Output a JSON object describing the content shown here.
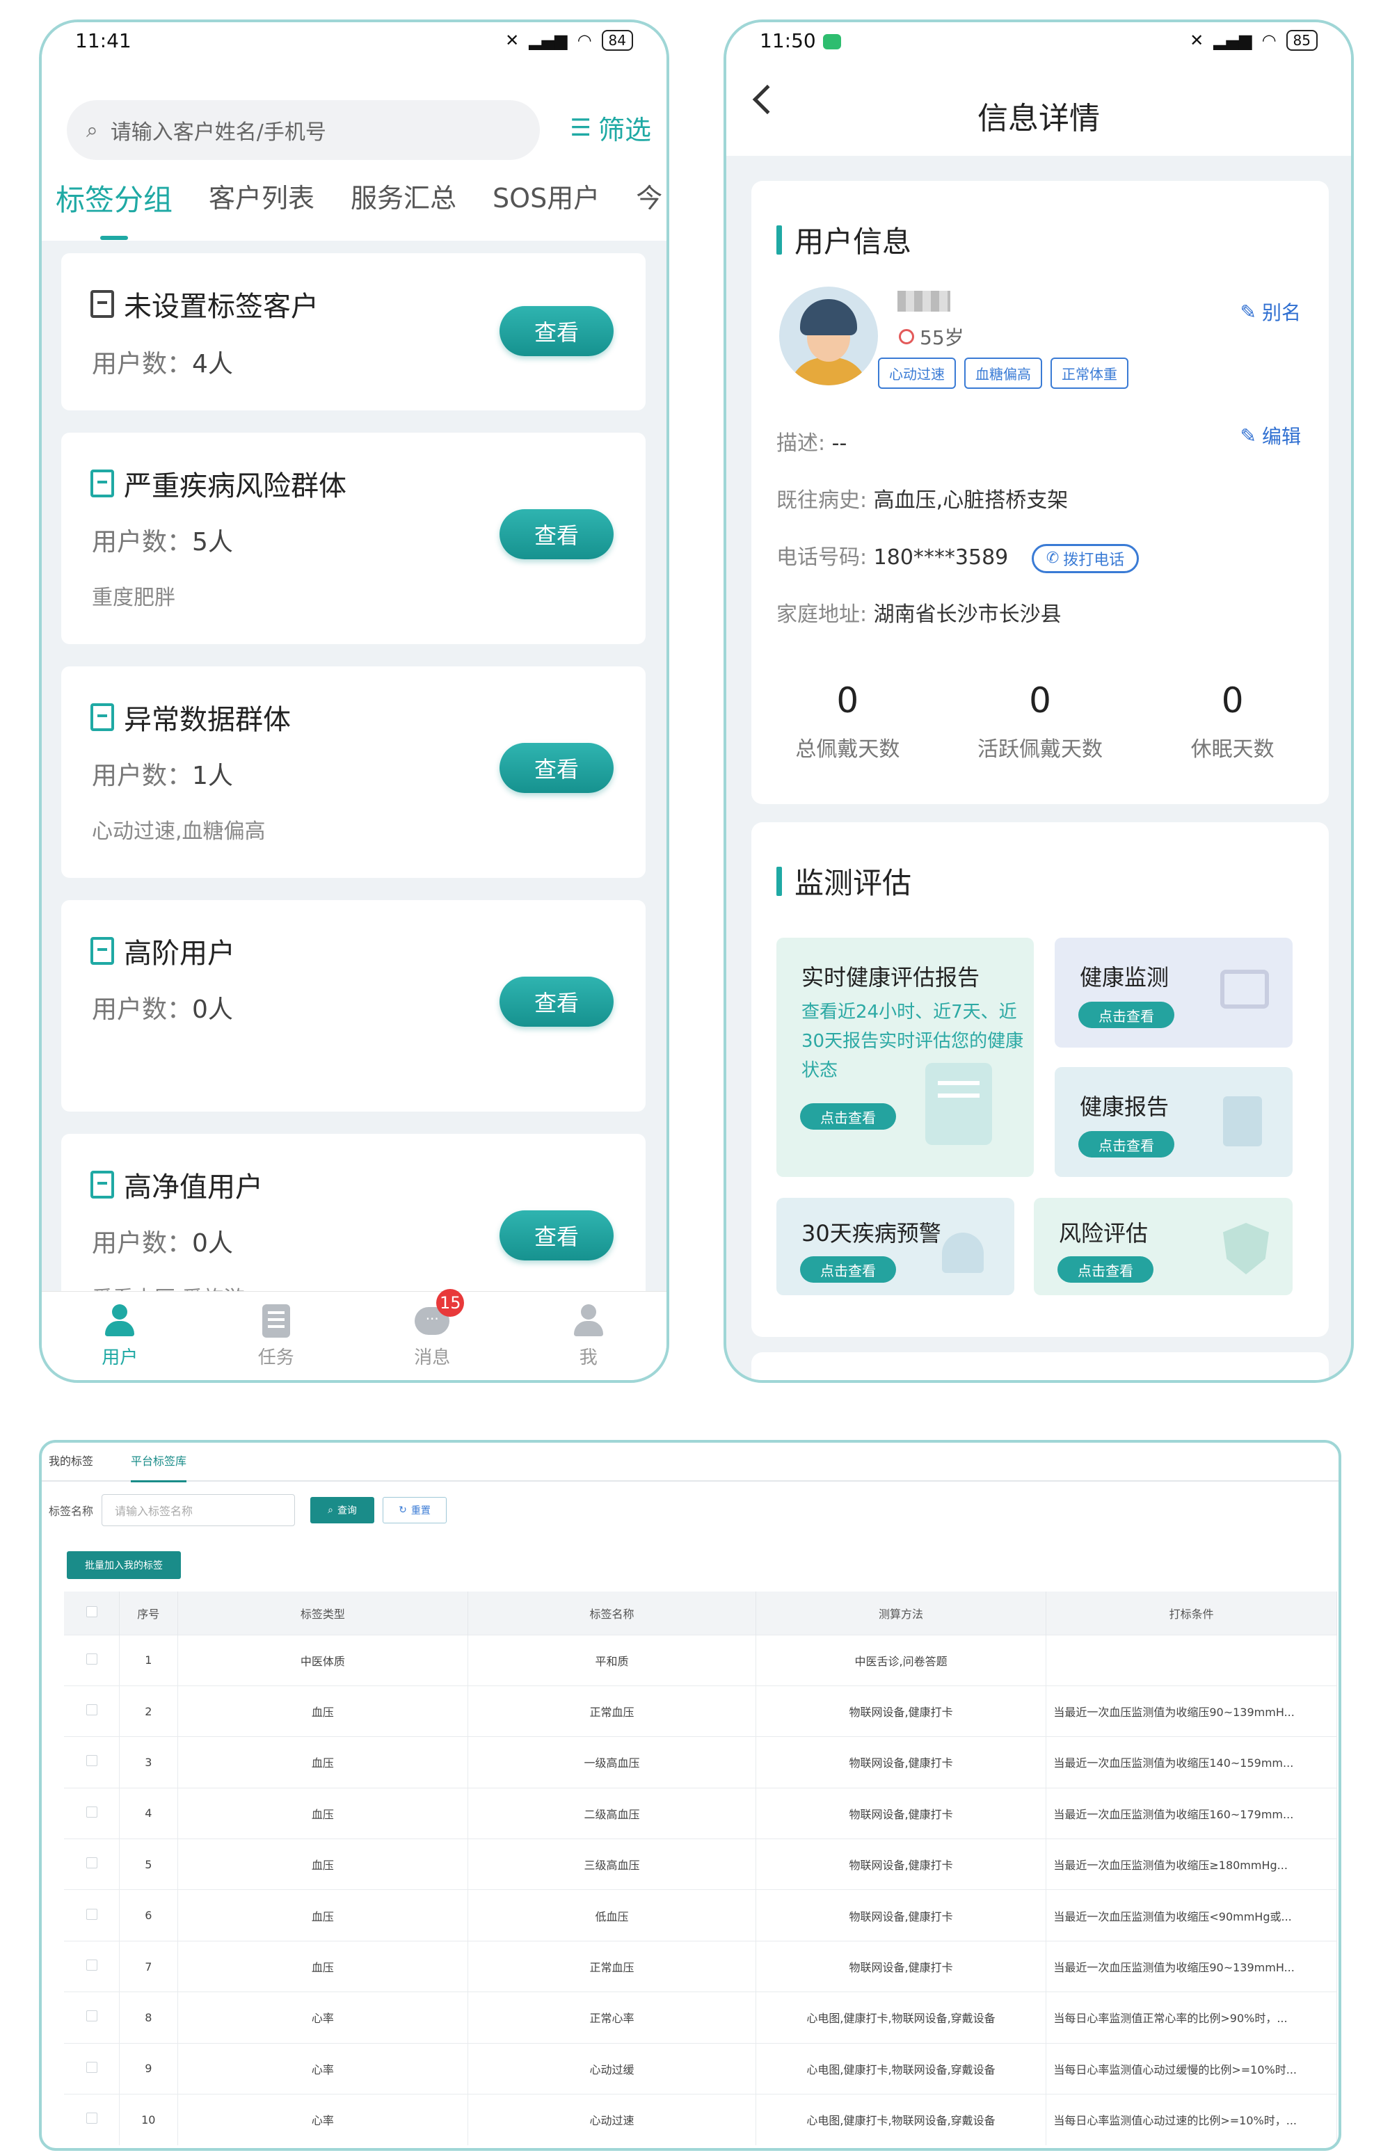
{
  "phone1": {
    "status": {
      "time": "11:41",
      "battery": "84"
    },
    "search": {
      "placeholder": "请输入客户姓名/手机号"
    },
    "filter_label": "筛选",
    "tabs": [
      {
        "label": "标签分组",
        "active": true
      },
      {
        "label": "客户列表",
        "active": false
      },
      {
        "label": "服务汇总",
        "active": false
      },
      {
        "label": "SOS用户",
        "active": false
      },
      {
        "label": "今",
        "active": false
      }
    ],
    "count_prefix": "用户数：",
    "view_label": "查看",
    "groups": [
      {
        "title": "未设置标签客户",
        "count": "4人",
        "desc": ""
      },
      {
        "title": "严重疾病风险群体",
        "count": "5人",
        "desc": "重度肥胖"
      },
      {
        "title": "异常数据群体",
        "count": "1人",
        "desc": "心动过速,血糖偏高"
      },
      {
        "title": "高阶用户",
        "count": "0人",
        "desc": ""
      },
      {
        "title": "高净值用户",
        "count": "0人",
        "desc": "爱看中医,爱旅游"
      }
    ],
    "nav": [
      {
        "label": "用户",
        "icon": "user-icon",
        "active": true
      },
      {
        "label": "任务",
        "icon": "task-icon",
        "active": false
      },
      {
        "label": "消息",
        "icon": "message-icon",
        "active": false,
        "badge": "15"
      },
      {
        "label": "我",
        "icon": "profile-icon",
        "active": false
      }
    ],
    "accent": "#1fa9a4"
  },
  "phone2": {
    "status": {
      "time": "11:50",
      "battery": "85"
    },
    "title": "信息详情",
    "user_section": "用户信息",
    "age": "55岁",
    "chips": [
      "心动过速",
      "血糖偏高",
      "正常体重"
    ],
    "alias_label": "别名",
    "edit_label": "编辑",
    "desc_label": "描述:",
    "desc_value": "--",
    "history_label": "既往病史:",
    "history_value": "高血压,心脏搭桥支架",
    "phone_label": "电话号码:",
    "phone_value": "180****3589",
    "call_label": "拨打电话",
    "address_label": "家庭地址:",
    "address_value": "湖南省长沙市长沙县",
    "stats": [
      {
        "value": "0",
        "label": "总佩戴天数"
      },
      {
        "value": "0",
        "label": "活跃佩戴天数"
      },
      {
        "value": "0",
        "label": "休眠天数"
      }
    ],
    "monitor_section": "监测评估",
    "tiles": {
      "report": {
        "title": "实时健康评估报告",
        "desc": "查看近24小时、近7天、近30天报告实时评估您的健康状态",
        "btn": "点击查看"
      },
      "monitor": {
        "title": "健康监测",
        "btn": "点击查看"
      },
      "health_report": {
        "title": "健康报告",
        "btn": "点击查看"
      },
      "warning": {
        "title": "30天疾病预警",
        "btn": "点击查看"
      },
      "risk": {
        "title": "风险评估",
        "btn": "点击查看"
      }
    }
  },
  "panel": {
    "tabs": [
      {
        "label": "我的标签",
        "active": false
      },
      {
        "label": "平台标签库",
        "active": true
      }
    ],
    "filter_label": "标签名称",
    "filter_placeholder": "请输入标签名称",
    "query_label": "查询",
    "reset_label": "重置",
    "batch_label": "批量加入我的标签",
    "columns": [
      "",
      "序号",
      "标签类型",
      "标签名称",
      "测算方法",
      "打标条件"
    ],
    "rows": [
      [
        "1",
        "中医体质",
        "平和质",
        "中医舌诊,问卷答题",
        ""
      ],
      [
        "2",
        "血压",
        "正常血压",
        "物联网设备,健康打卡",
        "当最近一次血压监测值为收缩压90~139mmH..."
      ],
      [
        "3",
        "血压",
        "一级高血压",
        "物联网设备,健康打卡",
        "当最近一次血压监测值为收缩压140~159mm..."
      ],
      [
        "4",
        "血压",
        "二级高血压",
        "物联网设备,健康打卡",
        "当最近一次血压监测值为收缩压160~179mm..."
      ],
      [
        "5",
        "血压",
        "三级高血压",
        "物联网设备,健康打卡",
        "当最近一次血压监测值为收缩压≥180mmHg..."
      ],
      [
        "6",
        "血压",
        "低血压",
        "物联网设备,健康打卡",
        "当最近一次血压监测值为收缩压<90mmHg或..."
      ],
      [
        "7",
        "血压",
        "正常血压",
        "物联网设备,健康打卡",
        "当最近一次血压监测值为收缩压90~139mmH..."
      ],
      [
        "8",
        "心率",
        "正常心率",
        "心电图,健康打卡,物联网设备,穿戴设备",
        "当每日心率监测值正常心率的比例>90%时，..."
      ],
      [
        "9",
        "心率",
        "心动过缓",
        "心电图,健康打卡,物联网设备,穿戴设备",
        "当每日心率监测值心动过缓慢的比例>=10%时..."
      ],
      [
        "10",
        "心率",
        "心动过速",
        "心电图,健康打卡,物联网设备,穿戴设备",
        "当每日心率监测值心动过速的比例>=10%时，..."
      ]
    ],
    "accent": "#1a8c89"
  }
}
